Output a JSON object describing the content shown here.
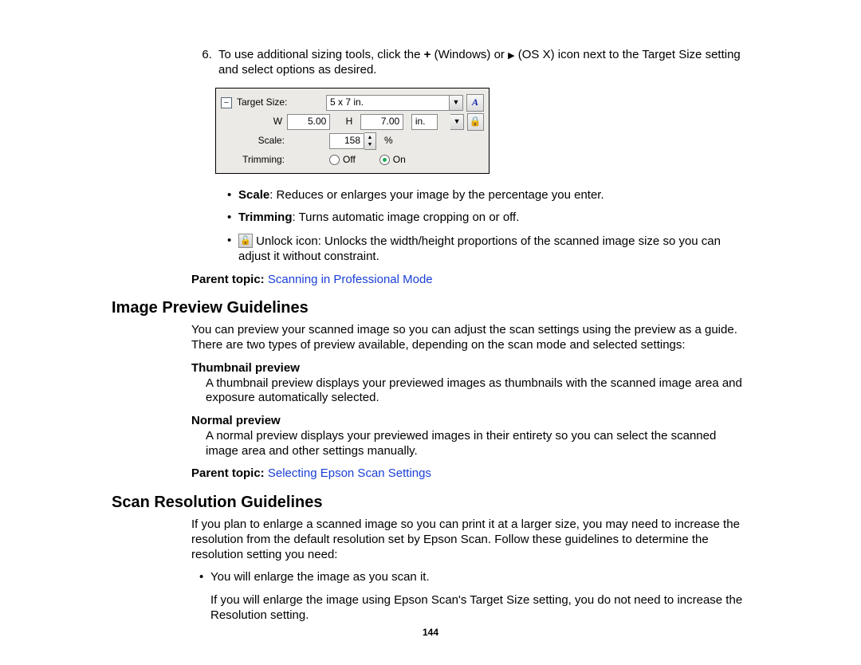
{
  "step6": {
    "number": "6.",
    "text_a": "To use additional sizing tools, click the ",
    "plus": "+",
    "text_b": " (Windows) or ",
    "play": "▶",
    "text_c": " (OS X) icon next to the Target Size setting and select options as desired."
  },
  "figure": {
    "expand_sym": "−",
    "target_size_label": "Target Size:",
    "target_size_value": "5 x 7 in.",
    "orient_icon": "A",
    "w_label": "W",
    "w_value": "5.00",
    "h_label": "H",
    "h_value": "7.00",
    "unit_value": "in.",
    "lock_icon": "🔒",
    "scale_label": "Scale:",
    "scale_value": "158",
    "scale_unit": "%",
    "trimming_label": "Trimming:",
    "off_label": "Off",
    "on_label": "On"
  },
  "bullets": {
    "scale_b": "Scale",
    "scale_t": ": Reduces or enlarges your image by the percentage you enter.",
    "trim_b": "Trimming",
    "trim_t": ": Turns automatic image cropping on or off.",
    "unlock_icon": "🔓",
    "unlock_t": " Unlock icon: Unlocks the width/height proportions of the scanned image size so you can adjust it without constraint."
  },
  "parent1": {
    "label": "Parent topic: ",
    "link": "Scanning in Professional Mode"
  },
  "sec1": {
    "title": "Image Preview Guidelines",
    "intro": "You can preview your scanned image so you can adjust the scan settings using the preview as a guide. There are two types of preview available, depending on the scan mode and selected settings:",
    "thumb_h": "Thumbnail preview",
    "thumb_b": "A thumbnail preview displays your previewed images as thumbnails with the scanned image area and exposure automatically selected.",
    "normal_h": "Normal preview",
    "normal_b": "A normal preview displays your previewed images in their entirety so you can select the scanned image area and other settings manually."
  },
  "parent2": {
    "label": "Parent topic: ",
    "link": "Selecting Epson Scan Settings"
  },
  "sec2": {
    "title": "Scan Resolution Guidelines",
    "intro": "If you plan to enlarge a scanned image so you can print it at a larger size, you may need to increase the resolution from the default resolution set by Epson Scan. Follow these guidelines to determine the resolution setting you need:",
    "li1": "You will enlarge the image as you scan it.",
    "li1b": "If you will enlarge the image using Epson Scan's Target Size setting, you do not need to increase the Resolution setting."
  },
  "page_number": "144"
}
